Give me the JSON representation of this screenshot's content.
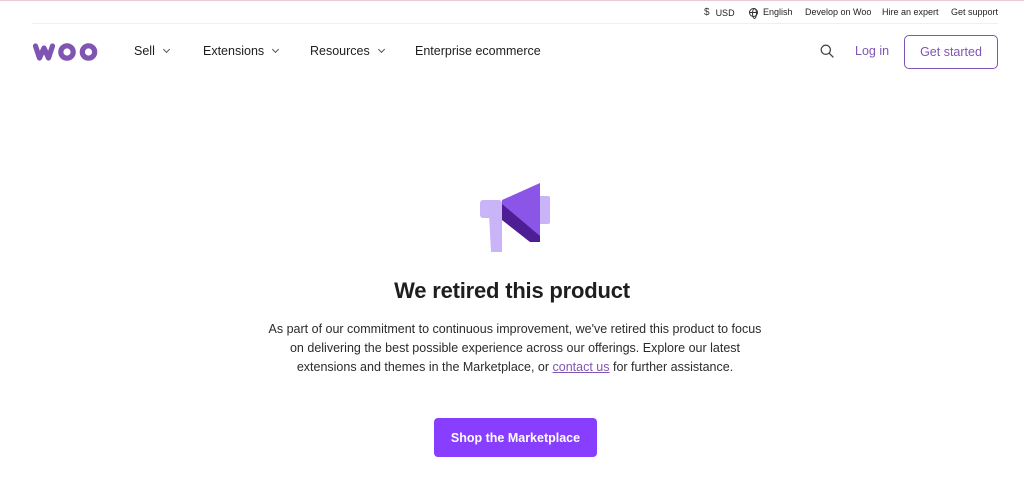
{
  "utility_bar": {
    "currency": "USD",
    "language": "English",
    "develop": "Develop on Woo",
    "hire": "Hire an expert",
    "support": "Get support"
  },
  "nav": {
    "logo_text": "woo",
    "items": [
      "Sell",
      "Extensions",
      "Resources",
      "Enterprise ecommerce"
    ],
    "login": "Log in",
    "cta": "Get started"
  },
  "hero": {
    "icon": "megaphone-icon",
    "headline": "We retired this product",
    "description_before": "As part of our commitment to continuous improvement, we've retired this product to focus on delivering the best possible experience across our offerings. Explore our latest extensions and themes in the Marketplace, or ",
    "description_link": "contact us",
    "description_after": " for further assistance.",
    "button": "Shop the Marketplace"
  },
  "colors": {
    "brand": "#7f54b3",
    "button": "#873eff",
    "icon_light": "#c9b4f7",
    "icon_mid": "#8b55e8",
    "icon_dark": "#4e1e94"
  }
}
